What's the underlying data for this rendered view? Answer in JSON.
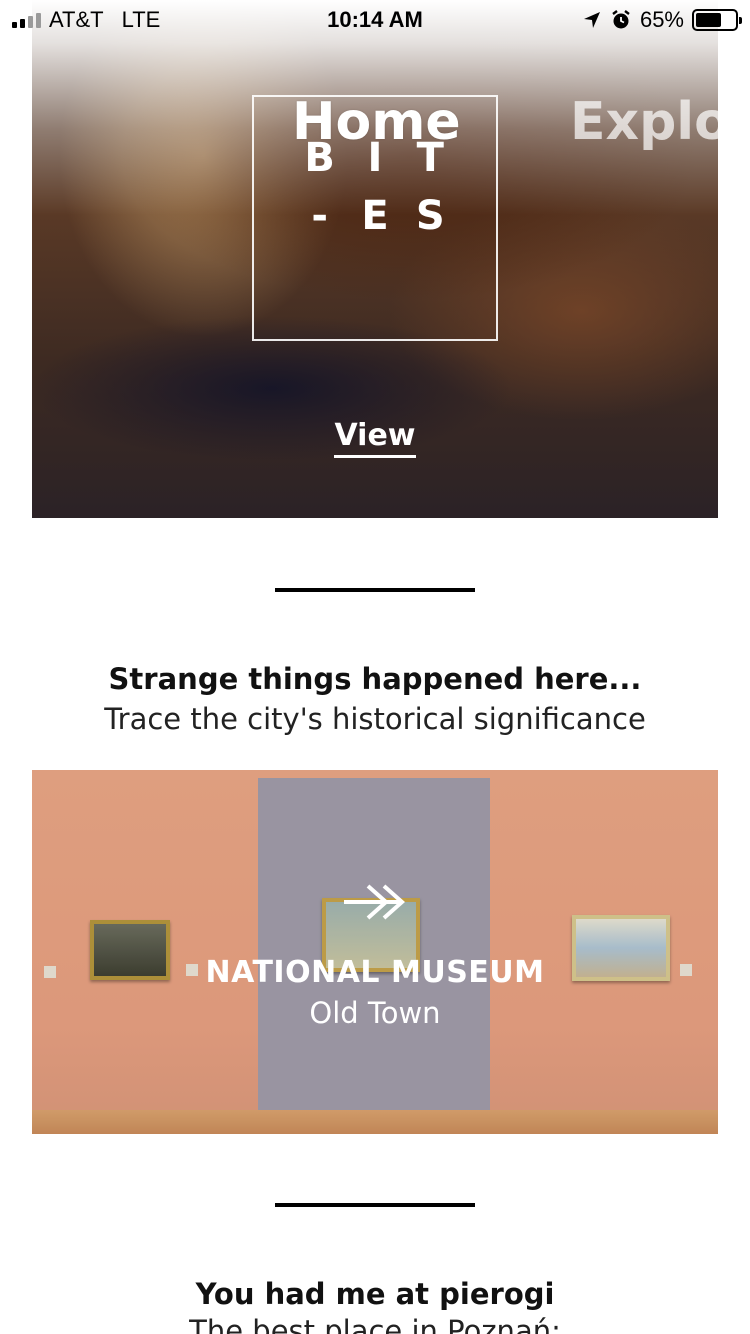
{
  "status_bar": {
    "carrier": "AT&T",
    "network": "LTE",
    "time": "10:14 AM",
    "battery_percent": "65%",
    "battery_level": 0.65,
    "signal_bars_active": 2,
    "signal_bars_total": 4
  },
  "nav": {
    "tabs": [
      {
        "label": "Home",
        "active": true
      },
      {
        "label": "Explore",
        "active": false
      }
    ]
  },
  "hero": {
    "logo_letters": [
      "B",
      "I",
      "T",
      "-",
      "E",
      "S"
    ],
    "view_label": "View"
  },
  "section_history": {
    "title": "Strange things happened here...",
    "subtitle": "Trace the city's historical significance"
  },
  "museum_card": {
    "arrow_icon": "double-arrow-right-icon",
    "title": "NATIONAL MUSEUM",
    "subtitle": "Old Town"
  },
  "section_pierogi": {
    "title": "You had me at pierogi",
    "subtitle": "The best place in Poznań:"
  }
}
